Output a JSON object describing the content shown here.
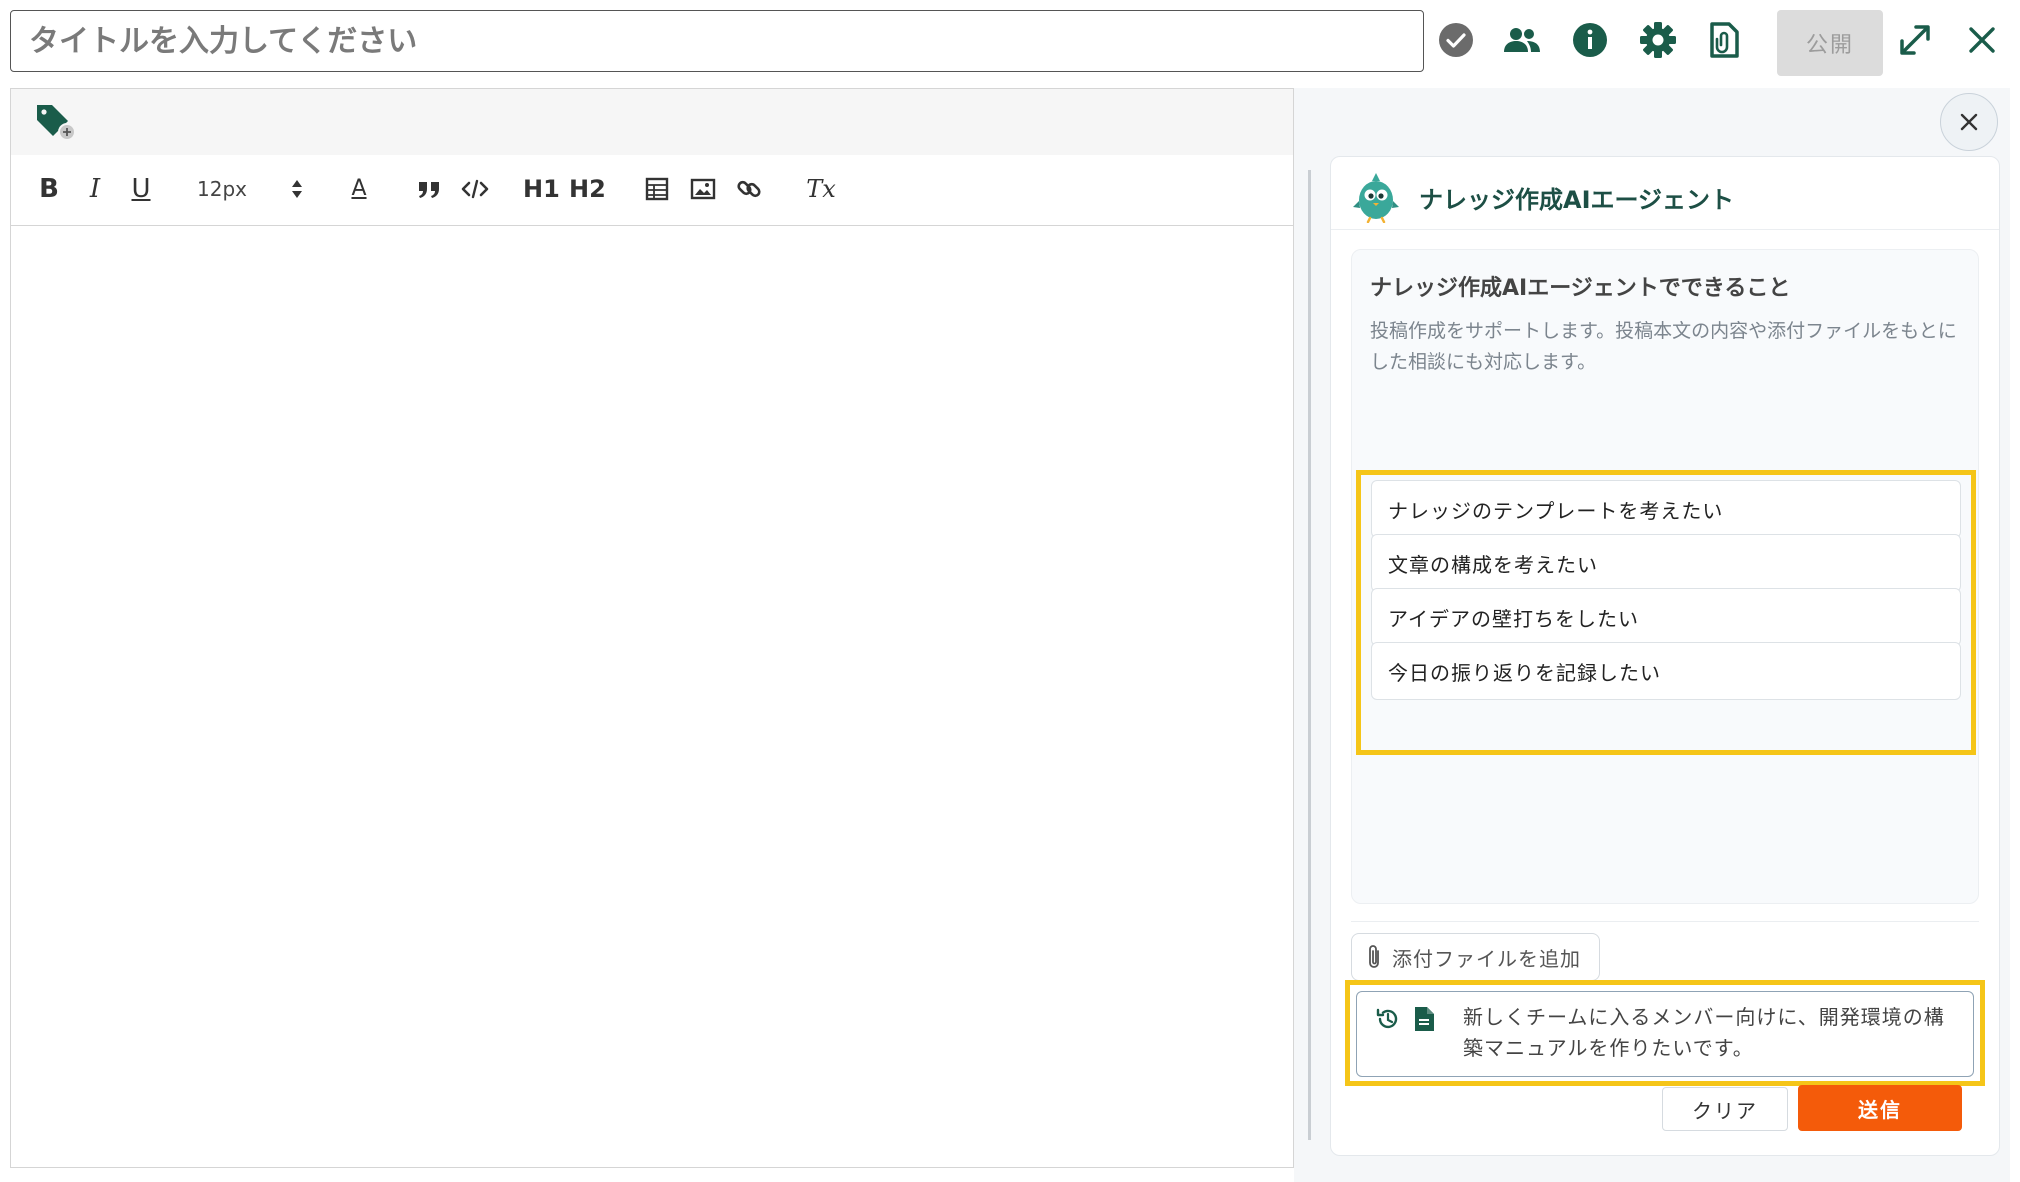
{
  "header": {
    "title_placeholder": "タイトルを入力してください",
    "icons": [
      "check-circle-icon",
      "people-icon",
      "info-icon",
      "gear-icon",
      "attachment-file-icon",
      "expand-icon",
      "close-icon"
    ],
    "publish_label": "公開"
  },
  "editor": {
    "tag_icon": "tag-add-icon",
    "toolbar": {
      "bold": "B",
      "italic": "I",
      "underline": "U",
      "font_size": "12px",
      "text_color": "A",
      "h1": "H1",
      "h2": "H2",
      "clear_format": "Tx"
    }
  },
  "ai_panel": {
    "title": "ナレッジ作成AIエージェント",
    "info_title": "ナレッジ作成AIエージェントでできること",
    "info_description": "投稿作成をサポートします。投稿本文の内容や添付ファイルをもとにした相談にも対応します。",
    "suggestions": [
      "ナレッジのテンプレートを考えたい",
      "文章の構成を考えたい",
      "アイデアの壁打ちをしたい",
      "今日の振り返りを記録したい"
    ],
    "attach_label": "添付ファイルを追加",
    "input_text": "新しくチームに入るメンバー向けに、開発環境の構築マニュアルを作りたいです。",
    "clear_label": "クリア",
    "send_label": "送信"
  },
  "colors": {
    "brand_green": "#1a5c4a",
    "highlight": "#f5c518",
    "send": "#f45b0a"
  }
}
